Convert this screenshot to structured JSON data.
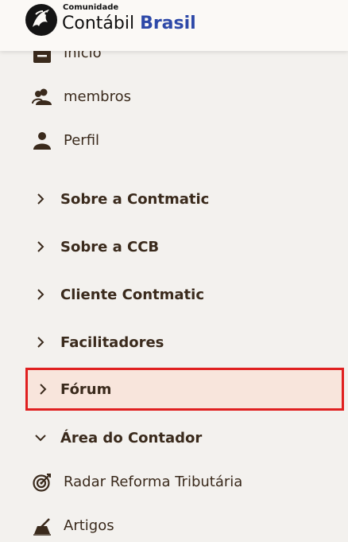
{
  "brand": {
    "small": "Comunidade",
    "main_a": "Contábil",
    "main_b": "Brasil",
    "accent_color": "#2e49a8",
    "logo_icon": "phoenix-logo-icon"
  },
  "nav": {
    "items": [
      {
        "label": "Início",
        "icon": "home-icon"
      },
      {
        "label": "membros",
        "icon": "members-icon"
      },
      {
        "label": "Perfil",
        "icon": "profile-icon"
      }
    ],
    "sections": [
      {
        "label": "Sobre a Contmatic",
        "expanded": false
      },
      {
        "label": "Sobre a CCB",
        "expanded": false
      },
      {
        "label": "Cliente Contmatic",
        "expanded": false
      },
      {
        "label": "Facilitadores",
        "expanded": false
      },
      {
        "label": "Fórum",
        "expanded": false,
        "highlighted": true
      },
      {
        "label": "Área do Contador",
        "expanded": true
      }
    ],
    "subitems": [
      {
        "label": "Radar Reforma Tributária",
        "icon": "target-icon"
      },
      {
        "label": "Artigos",
        "icon": "writing-icon"
      }
    ]
  },
  "colors": {
    "text": "#3a2a1c",
    "highlight_bg": "#f8e5dc",
    "highlight_border": "#e02020"
  }
}
